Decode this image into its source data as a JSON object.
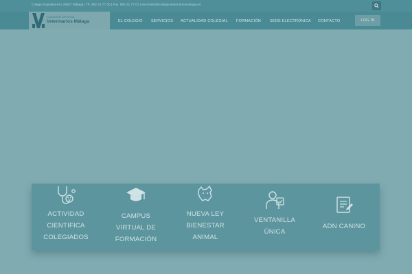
{
  "topbar": {
    "info": "Colegio Expositores | 29007 Málaga | Tfl. 952 31 77 00 | Fax. 952 31 77 01 | secretaria@colegioveterinariosmalaga.es"
  },
  "header": {
    "logo_small": "COLEGIO OFICIAL",
    "logo_big": "Veterinarios Málaga",
    "nav": [
      "EL COLEGIO",
      "SERVICIOS",
      "ACTUALIDAD COLEGIAL",
      "FORMACIÓN",
      "SEDE ELECTRÓNICA",
      "CONTACTO"
    ],
    "login_label": "LOG IN"
  },
  "features": [
    {
      "icon": "vet-stethoscope-icon",
      "lines": [
        "ACTIVIDAD",
        "CIENTIFICA",
        "COLEGIADOS"
      ]
    },
    {
      "icon": "graduation-cap-icon",
      "lines": [
        "CAMPUS",
        "VIRTUAL DE",
        "FORMACIÓN"
      ]
    },
    {
      "icon": "animal-welfare-icon",
      "lines": [
        "NUEVA LEY",
        "BIENESTAR",
        "ANIMAL"
      ]
    },
    {
      "icon": "single-window-icon",
      "lines": [
        "VENTANILLA",
        "ÚNICA"
      ]
    },
    {
      "icon": "dna-document-icon",
      "lines": [
        "ADN CANINO"
      ]
    }
  ],
  "colors": {
    "topbar": "#4f8f99",
    "navbar": "#4a8a95",
    "background": "#7fabb1",
    "features_bg": "#5d959e"
  }
}
